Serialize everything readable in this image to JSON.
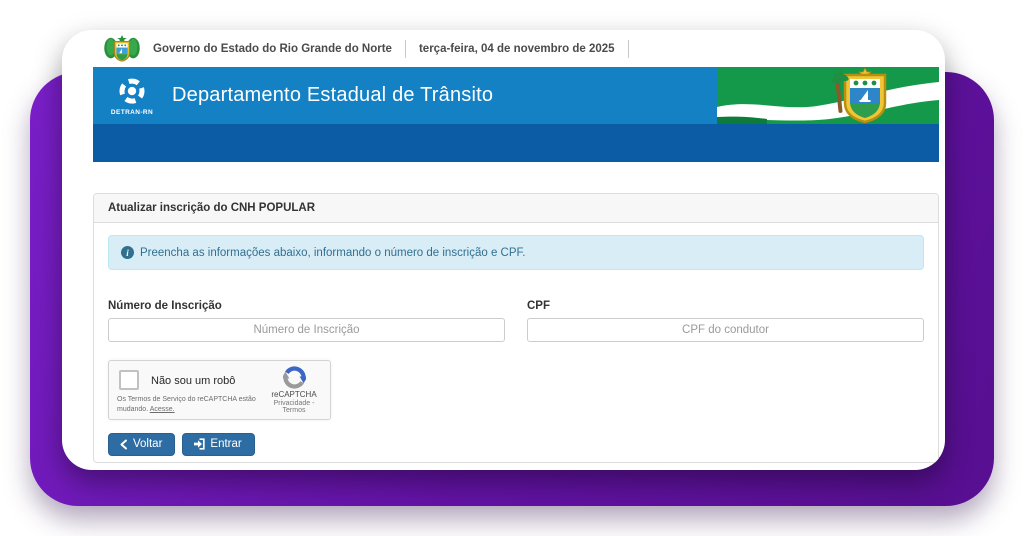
{
  "topbar": {
    "government": "Governo do Estado do Rio Grande do Norte",
    "date": "terça-feira, 04 de novembro de 2025"
  },
  "header": {
    "title": "Departamento Estadual de Trânsito",
    "logo_caption": "DETRAN-RN"
  },
  "panel": {
    "title": "Atualizar inscrição do CNH POPULAR",
    "alert_text": "Preencha as informações abaixo, informando o número de inscrição e CPF."
  },
  "form": {
    "inscricao": {
      "label": "Número de Inscrição",
      "placeholder": "Número de Inscrição",
      "value": ""
    },
    "cpf": {
      "label": "CPF",
      "placeholder": "CPF do condutor",
      "value": ""
    }
  },
  "recaptcha": {
    "label": "Não sou um robô",
    "brand": "reCAPTCHA",
    "links_text": "Privacidade - Termos",
    "notice_text": "Os Termos de Serviço do reCAPTCHA estão mudando. ",
    "notice_link": "Acesse."
  },
  "actions": {
    "back_label": "Voltar",
    "enter_label": "Entrar"
  },
  "icons": {
    "info": "i"
  },
  "colors": {
    "header_blue": "#1581c5",
    "strip_blue": "#0c5ca5",
    "background_purple": "#6312a5",
    "button_blue": "#2e6da4",
    "alert_bg": "#d9edf7",
    "alert_text": "#31708f",
    "flag_green": "#14994a",
    "recaptcha_bg": "#f9f9f9"
  }
}
